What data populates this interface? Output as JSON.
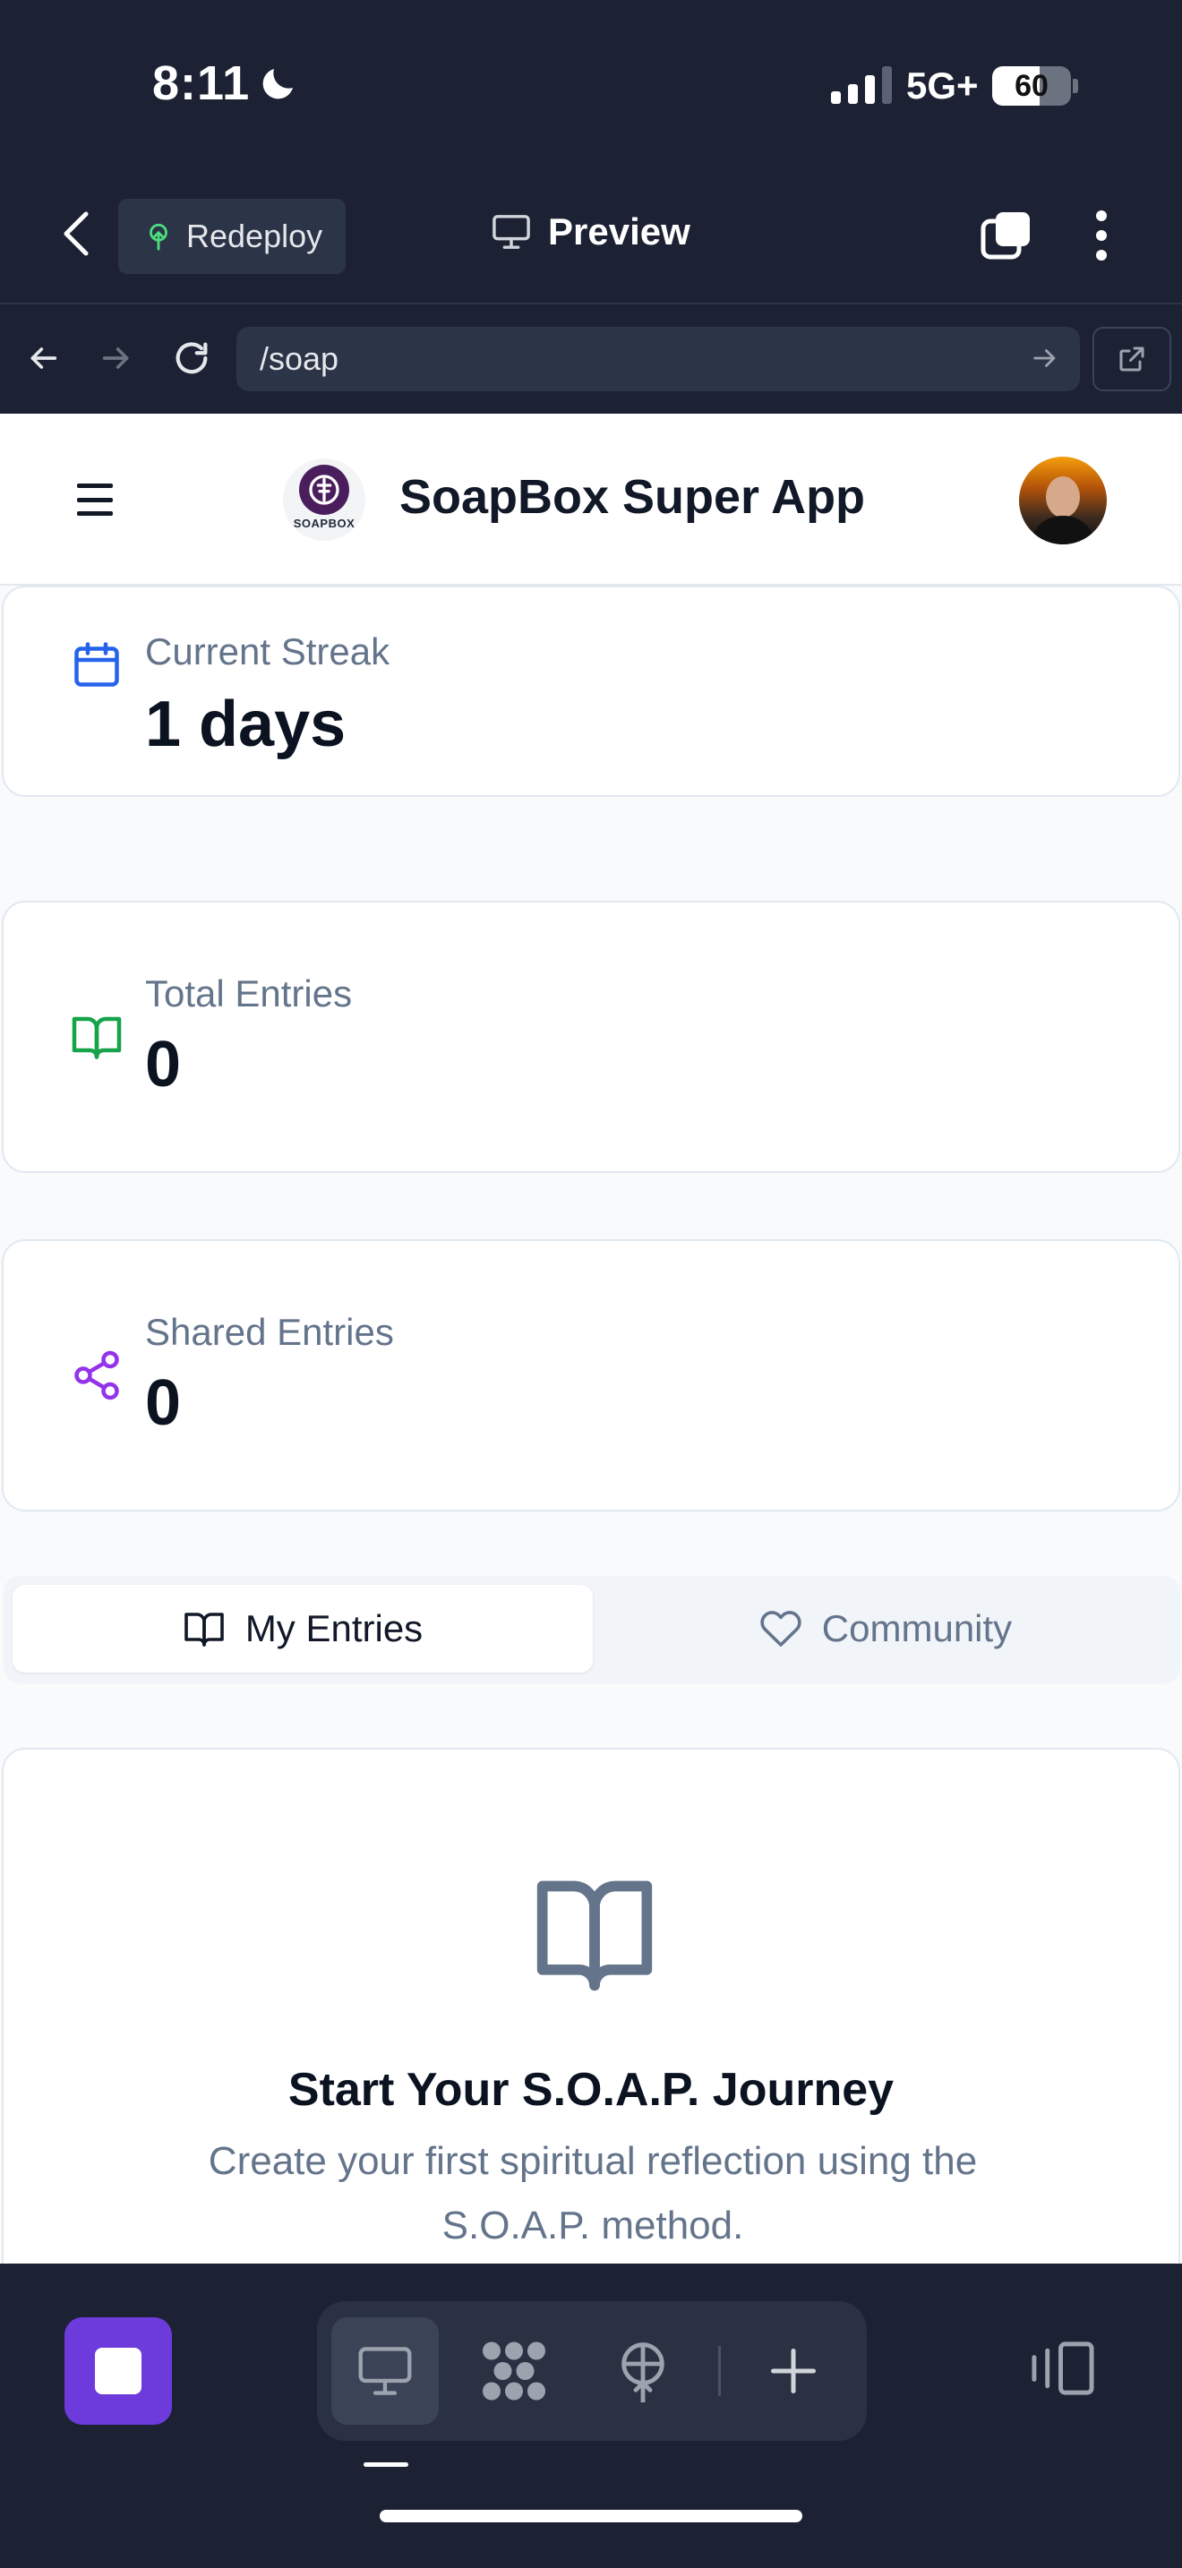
{
  "status_bar": {
    "time": "8:11",
    "network": "5G+",
    "battery": "60",
    "battery_level": 0.6,
    "icons": [
      "moon-icon",
      "signal-icon",
      "battery-icon"
    ]
  },
  "toolbar": {
    "redeploy_label": "Redeploy",
    "preview_label": "Preview",
    "icons": [
      "back-icon",
      "redeploy-icon",
      "monitor-icon",
      "tabs-icon",
      "more-icon"
    ]
  },
  "url_bar": {
    "url": "/soap",
    "icons": [
      "arrow-left-icon",
      "arrow-right-icon",
      "reload-icon",
      "go-arrow-icon",
      "external-link-icon"
    ]
  },
  "app": {
    "title": "SoapBox Super App",
    "logo_text": "SOAPBOX"
  },
  "stats": [
    {
      "label": "Current Streak",
      "value": "1 days",
      "icon": "calendar-icon",
      "color": "#2563eb"
    },
    {
      "label": "Total Entries",
      "value": "0",
      "icon": "book-open-icon",
      "color": "#16a34a"
    },
    {
      "label": "Shared Entries",
      "value": "0",
      "icon": "share-icon",
      "color": "#9333ea"
    }
  ],
  "tabs": [
    {
      "label": "My Entries",
      "icon": "book-open-icon",
      "active": true
    },
    {
      "label": "Community",
      "icon": "heart-icon",
      "active": false
    }
  ],
  "empty_state": {
    "title": "Start Your S.O.A.P. Journey",
    "subtitle": "Create your first spiritual reflection using the S.O.A.P. method."
  },
  "dock": {
    "items": [
      "stop-icon",
      "monitor-icon",
      "apps-grid-icon",
      "deploy-icon",
      "plus-icon",
      "panel-toggle-icon"
    ],
    "accent": "#6d3bdb"
  }
}
